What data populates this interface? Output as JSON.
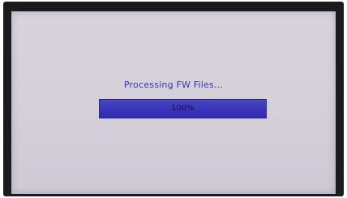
{
  "status_message": "Processing FW Files...",
  "progress": {
    "label": "100%",
    "fraction": 1.0
  },
  "colors": {
    "text": "#3a36b0",
    "bar_fill": "#3a34b8",
    "screen_bg": "#d8d3dc",
    "bezel": "#1b1a1d"
  }
}
